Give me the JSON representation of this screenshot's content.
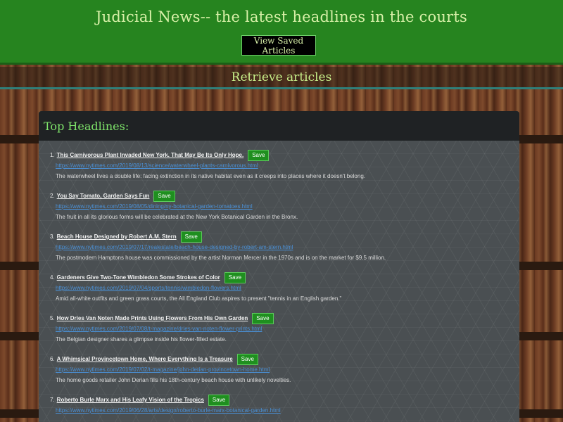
{
  "header": {
    "title": "Judicial News-- the latest headlines in the courts",
    "saved_button": "View Saved Articles"
  },
  "nav": {
    "retrieve": "Retrieve articles"
  },
  "panel": {
    "title": "Top Headlines:",
    "save_label": "Save",
    "articles": [
      {
        "num": "1.",
        "headline": "This Carnivorous Plant Invaded New York. That May Be Its Only Hope.",
        "url": "https://www.nytimes.com/2019/08/13/science/waterwheel-plants-carnivorous.html",
        "summary": "The waterwheel lives a double life: facing extinction in its native habitat even as it creeps into places where it doesn't belong."
      },
      {
        "num": "2.",
        "headline": "You Say Tomato, Garden Says Fun",
        "url": "https://www.nytimes.com/2019/08/05/dining/ny-botanical-garden-tomatoes.html",
        "summary": "The fruit in all its glorious forms will be celebrated at the New York Botanical Garden in the Bronx."
      },
      {
        "num": "3.",
        "headline": "Beach House Designed by Robert A.M. Stern",
        "url": "https://www.nytimes.com/2019/07/17/realestate/beach-house-designed-by-robert-am-stern.html",
        "summary": "The postmodern Hamptons house was commissioned by the artist Norman Mercer in the 1970s and is on the market for $9.5 million."
      },
      {
        "num": "4.",
        "headline": "Gardeners Give Two-Tone Wimbledon Some Strokes of Color",
        "url": "https://www.nytimes.com/2019/07/04/sports/tennis/wimbledon-flowers.html",
        "summary": "Amid all-white outfits and green grass courts, the All England Club aspires to present \"tennis in an English garden.\""
      },
      {
        "num": "5.",
        "headline": "How Dries Van Noten Made Prints Using Flowers From His Own Garden",
        "url": "https://www.nytimes.com/2019/07/08/t-magazine/dries-van-noten-flower-prints.html",
        "summary": "The Belgian designer shares a glimpse inside his flower-filled estate."
      },
      {
        "num": "6.",
        "headline": "A Whimsical Provincetown Home, Where Everything Is a Treasure",
        "url": "https://www.nytimes.com/2019/07/02/t-magazine/john-derian-provincetown-home.html",
        "summary": "The home goods retailer John Derian fills his 18th-century beach house with unlikely novelties."
      },
      {
        "num": "7.",
        "headline": "Roberto Burle Marx and His Leafy Vision of the Tropics",
        "url": "https://www.nytimes.com/2019/06/28/arts/design/roberto-burle-marx-botanical-garden.html",
        "summary": ""
      }
    ]
  }
}
